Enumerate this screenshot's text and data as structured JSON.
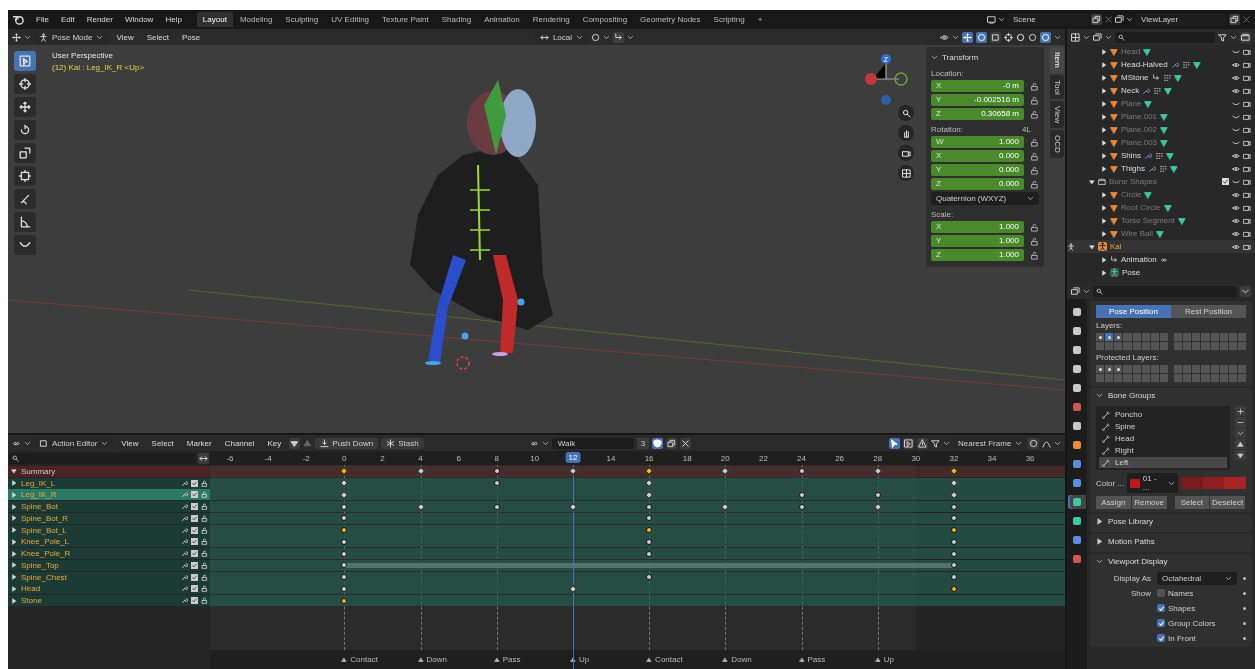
{
  "topbar": {
    "menus": [
      "File",
      "Edit",
      "Render",
      "Window",
      "Help"
    ],
    "workspaces": [
      {
        "label": "Layout",
        "selected": true
      },
      {
        "label": "Modeling",
        "selected": false
      },
      {
        "label": "Sculpting",
        "selected": false
      },
      {
        "label": "UV Editing",
        "selected": false
      },
      {
        "label": "Texture Paint",
        "selected": false
      },
      {
        "label": "Shading",
        "selected": false
      },
      {
        "label": "Animation",
        "selected": false
      },
      {
        "label": "Rendering",
        "selected": false
      },
      {
        "label": "Compositing",
        "selected": false
      },
      {
        "label": "Geometry Nodes",
        "selected": false
      },
      {
        "label": "Scripting",
        "selected": false
      }
    ],
    "add_tab": "+",
    "scene": "Scene",
    "view_layer": "ViewLayer"
  },
  "viewport": {
    "mode": "Pose Mode",
    "menus": [
      "View",
      "Select",
      "Pose"
    ],
    "orientation": "Local",
    "title": "User Perspective",
    "info": "(12) Kai : Leg_IK_R <Up>",
    "gizmo_label": "Z",
    "tools": [
      {
        "kind": "select",
        "selected": true
      },
      {
        "kind": "cursor",
        "selected": false
      },
      {
        "kind": "move",
        "selected": false
      },
      {
        "kind": "rotate",
        "selected": false
      },
      {
        "kind": "scale",
        "selected": false
      },
      {
        "kind": "transform",
        "selected": false
      },
      {
        "kind": "annotate",
        "selected": false
      },
      {
        "kind": "measure",
        "selected": false
      },
      {
        "kind": "relax",
        "selected": false
      }
    ],
    "sidebar_tabs": [
      {
        "label": "Item",
        "selected": true
      },
      {
        "label": "Tool",
        "selected": false
      },
      {
        "label": "View",
        "selected": false
      },
      {
        "label": "OCD",
        "selected": false
      }
    ],
    "transform": {
      "title": "Transform",
      "location_label": "Location:",
      "location": [
        {
          "axis": "X",
          "value": "-0 m"
        },
        {
          "axis": "Y",
          "value": "-0.002516 m"
        },
        {
          "axis": "Z",
          "value": "0.30658 m"
        }
      ],
      "rotation_label": "Rotation:",
      "rotation_badge": "4L",
      "rotation": [
        {
          "axis": "W",
          "value": "1.000"
        },
        {
          "axis": "X",
          "value": "0.000"
        },
        {
          "axis": "Y",
          "value": "0.000"
        },
        {
          "axis": "Z",
          "value": "0.000"
        }
      ],
      "rotation_mode": "Quaternion (WXYZ)",
      "scale_label": "Scale:",
      "scale": [
        {
          "axis": "X",
          "value": "1.000"
        },
        {
          "axis": "Y",
          "value": "1.000"
        },
        {
          "axis": "Z",
          "value": "1.000"
        }
      ]
    }
  },
  "outliner": {
    "items": [
      {
        "name": "Head",
        "kind": "mesh",
        "inactive": true,
        "hidden": true,
        "has_modifiers": false,
        "has_hook": false
      },
      {
        "name": "Head-Halved",
        "kind": "mesh",
        "inactive": false,
        "hidden": false,
        "has_modifiers": true,
        "has_hook": false
      },
      {
        "name": "MStone",
        "kind": "mesh",
        "inactive": false,
        "hidden": false,
        "has_modifiers": false,
        "has_hook": true
      },
      {
        "name": "Neck",
        "kind": "mesh",
        "inactive": false,
        "hidden": false,
        "has_modifiers": true,
        "has_hook": false
      },
      {
        "name": "Plane",
        "kind": "mesh",
        "inactive": true,
        "hidden": true,
        "has_modifiers": false,
        "has_hook": false
      },
      {
        "name": "Plane.001",
        "kind": "mesh",
        "inactive": true,
        "hidden": true,
        "has_modifiers": false,
        "has_hook": false
      },
      {
        "name": "Plane.002",
        "kind": "mesh",
        "inactive": true,
        "hidden": true,
        "has_modifiers": false,
        "has_hook": false
      },
      {
        "name": "Plane.003",
        "kind": "mesh",
        "inactive": true,
        "hidden": true,
        "has_modifiers": false,
        "has_hook": false
      },
      {
        "name": "Shins",
        "kind": "mesh",
        "inactive": false,
        "hidden": false,
        "has_modifiers": true,
        "has_hook": false
      },
      {
        "name": "Thighs",
        "kind": "mesh",
        "inactive": false,
        "hidden": false,
        "has_modifiers": true,
        "has_hook": false
      },
      {
        "name": "Bone Shapes",
        "kind": "collection",
        "inactive": true,
        "hidden": true,
        "checked": true,
        "expanded": true,
        "children": [
          {
            "name": "Circle",
            "kind": "mesh",
            "inactive": true,
            "hidden": false,
            "has_modifiers": false,
            "has_hook": false
          },
          {
            "name": "Root Circle",
            "kind": "mesh",
            "inactive": true,
            "hidden": false,
            "has_modifiers": false,
            "has_hook": false
          },
          {
            "name": "Torso Segment",
            "kind": "mesh",
            "inactive": true,
            "hidden": false,
            "has_modifiers": false,
            "has_hook": false
          },
          {
            "name": "Wire Ball",
            "kind": "mesh",
            "inactive": true,
            "hidden": false,
            "has_modifiers": false,
            "has_hook": false
          }
        ]
      },
      {
        "name": "Kai",
        "kind": "armature",
        "inactive": false,
        "hidden": false,
        "expanded": true,
        "children": [
          {
            "name": "Animation",
            "kind": "animation",
            "inactive": false
          },
          {
            "name": "Pose",
            "kind": "pose",
            "inactive": false
          }
        ]
      }
    ]
  },
  "properties": {
    "editor_tabs": [
      {
        "kind": "tool",
        "selected": false
      },
      {
        "kind": "render",
        "selected": false
      },
      {
        "kind": "output",
        "selected": false
      },
      {
        "kind": "view-layer",
        "selected": false
      },
      {
        "kind": "scene",
        "selected": false
      },
      {
        "kind": "world",
        "selected": false
      },
      {
        "kind": "collection",
        "selected": false
      },
      {
        "kind": "object",
        "selected": false
      },
      {
        "kind": "physics",
        "selected": false
      },
      {
        "kind": "constraint",
        "selected": false
      },
      {
        "kind": "armature",
        "selected": true
      },
      {
        "kind": "bone",
        "selected": false
      },
      {
        "kind": "bone-constraint",
        "selected": false
      },
      {
        "kind": "texture",
        "selected": false
      }
    ],
    "position_tabs": [
      {
        "label": "Pose Position",
        "selected": true
      },
      {
        "label": "Rest Position",
        "selected": false
      }
    ],
    "layers_label": "Layers:",
    "layers": [
      {
        "used": true,
        "selected": false
      },
      {
        "used": true,
        "selected": true
      },
      {
        "used": true,
        "selected": false
      }
    ],
    "protected_label": "Protected Layers:",
    "protected": [
      {
        "used": true,
        "selected": false
      },
      {
        "used": true,
        "selected": false
      },
      {
        "used": true,
        "selected": false
      }
    ],
    "bone_groups": {
      "title": "Bone Groups",
      "expanded": true,
      "items": [
        {
          "name": "Poncho",
          "selected": false
        },
        {
          "name": "Spine",
          "selected": false
        },
        {
          "name": "Head",
          "selected": false
        },
        {
          "name": "Right",
          "selected": false
        },
        {
          "name": "Left",
          "selected": true
        }
      ],
      "color_label": "Color ...",
      "color_value": "01 - ...",
      "swatches": [
        {
          "color": "#7a1b1e"
        },
        {
          "color": "#8e1f22"
        },
        {
          "color": "#a62326"
        }
      ],
      "buttons": [
        "Assign",
        "Remove",
        "Select",
        "Deselect"
      ]
    },
    "panels": [
      {
        "title": "Pose Library",
        "expanded": false
      },
      {
        "title": "Motion Paths",
        "expanded": false
      }
    ],
    "viewport_display": {
      "title": "Viewport Display",
      "expanded": true,
      "display_as_label": "Display As",
      "display_as": "Octahedral",
      "show_label": "Show",
      "options": [
        {
          "label": "Names",
          "checked": false
        },
        {
          "label": "Shapes",
          "checked": true
        },
        {
          "label": "Group Colors",
          "checked": true
        },
        {
          "label": "In Front",
          "checked": true
        }
      ]
    }
  },
  "action_editor": {
    "mode": "Action Editor",
    "menus": [
      "View",
      "Select",
      "Marker",
      "Channel",
      "Key"
    ],
    "push_down": "Push Down",
    "stash": "Stash",
    "action": "Walk",
    "users": "3",
    "fake_user": true,
    "snap": "Nearest Frame"
  },
  "dopesheet": {
    "ticks": [
      "-6",
      "-4",
      "-2",
      "0",
      "2",
      "4",
      "6",
      "8",
      "10",
      "14",
      "16",
      "18",
      "20",
      "22",
      "24",
      "26",
      "28",
      "30",
      "32",
      "34",
      "36"
    ],
    "current_frame": "12",
    "channels": [
      {
        "name": "Summary",
        "kind": "summary",
        "expanded": true,
        "selected": false,
        "hold": false,
        "keys": [
          {
            "kind": "diamond",
            "selected": true
          },
          {
            "kind": "diamond",
            "selected": false
          },
          {
            "kind": "circle",
            "selected": false
          },
          {
            "kind": "diamond",
            "selected": false
          },
          {
            "kind": "diamond",
            "selected": true
          },
          {
            "kind": "diamond",
            "selected": false
          },
          {
            "kind": "circle",
            "selected": false
          },
          {
            "kind": "diamond",
            "selected": false
          },
          {
            "kind": "diamond",
            "selected": true
          }
        ]
      },
      {
        "name": "Leg_IK_L",
        "kind": "group",
        "expanded": false,
        "selected": false,
        "hold": false,
        "keys": [
          {
            "kind": "diamond",
            "selected": false
          },
          {
            "kind": "none"
          },
          {
            "kind": "circle",
            "selected": false
          },
          {
            "kind": "none"
          },
          {
            "kind": "diamond",
            "selected": false
          },
          {
            "kind": "none"
          },
          {
            "kind": "none"
          },
          {
            "kind": "none"
          },
          {
            "kind": "diamond",
            "selected": false
          }
        ]
      },
      {
        "name": "Leg_IK_R",
        "kind": "group",
        "expanded": false,
        "selected": true,
        "hold": false,
        "keys": [
          {
            "kind": "diamond",
            "selected": false
          },
          {
            "kind": "none"
          },
          {
            "kind": "none"
          },
          {
            "kind": "none"
          },
          {
            "kind": "diamond",
            "selected": false
          },
          {
            "kind": "none"
          },
          {
            "kind": "circle",
            "selected": false
          },
          {
            "kind": "circle",
            "selected": false
          },
          {
            "kind": "diamond",
            "selected": false
          }
        ]
      },
      {
        "name": "Spine_Bot",
        "kind": "group",
        "expanded": false,
        "selected": false,
        "hold": false,
        "keys": [
          {
            "kind": "circle",
            "selected": false
          },
          {
            "kind": "diamond",
            "selected": false
          },
          {
            "kind": "circle",
            "selected": false
          },
          {
            "kind": "diamond",
            "selected": false
          },
          {
            "kind": "circle",
            "selected": false
          },
          {
            "kind": "diamond",
            "selected": false
          },
          {
            "kind": "circle",
            "selected": false
          },
          {
            "kind": "diamond",
            "selected": false
          },
          {
            "kind": "circle",
            "selected": false
          }
        ]
      },
      {
        "name": "Spine_Bot_R",
        "kind": "group",
        "expanded": false,
        "selected": false,
        "hold": false,
        "keys": [
          {
            "kind": "circle",
            "selected": false
          },
          {
            "kind": "none"
          },
          {
            "kind": "none"
          },
          {
            "kind": "none"
          },
          {
            "kind": "circle",
            "selected": false
          },
          {
            "kind": "none"
          },
          {
            "kind": "none"
          },
          {
            "kind": "none"
          },
          {
            "kind": "circle",
            "selected": false
          }
        ]
      },
      {
        "name": "Spine_Bot_L",
        "kind": "group",
        "expanded": false,
        "selected": false,
        "hold": false,
        "keys": [
          {
            "kind": "circle",
            "selected": true
          },
          {
            "kind": "none"
          },
          {
            "kind": "none"
          },
          {
            "kind": "none"
          },
          {
            "kind": "circle",
            "selected": true
          },
          {
            "kind": "none"
          },
          {
            "kind": "none"
          },
          {
            "kind": "none"
          },
          {
            "kind": "circle",
            "selected": true
          }
        ]
      },
      {
        "name": "Knee_Pole_L",
        "kind": "group",
        "expanded": false,
        "selected": false,
        "hold": false,
        "keys": [
          {
            "kind": "circle",
            "selected": false
          },
          {
            "kind": "none"
          },
          {
            "kind": "none"
          },
          {
            "kind": "none"
          },
          {
            "kind": "circle",
            "selected": false
          },
          {
            "kind": "none"
          },
          {
            "kind": "none"
          },
          {
            "kind": "none"
          },
          {
            "kind": "circle",
            "selected": false
          }
        ]
      },
      {
        "name": "Knee_Pole_R",
        "kind": "group",
        "expanded": false,
        "selected": false,
        "hold": false,
        "keys": [
          {
            "kind": "circle",
            "selected": false
          },
          {
            "kind": "none"
          },
          {
            "kind": "none"
          },
          {
            "kind": "none"
          },
          {
            "kind": "circle",
            "selected": false
          },
          {
            "kind": "none"
          },
          {
            "kind": "none"
          },
          {
            "kind": "none"
          },
          {
            "kind": "circle",
            "selected": false
          }
        ]
      },
      {
        "name": "Spine_Top",
        "kind": "group",
        "expanded": false,
        "selected": false,
        "hold": true,
        "keys": [
          {
            "kind": "circle",
            "selected": false
          },
          {
            "kind": "none"
          },
          {
            "kind": "none"
          },
          {
            "kind": "none"
          },
          {
            "kind": "none"
          },
          {
            "kind": "none"
          },
          {
            "kind": "none"
          },
          {
            "kind": "none"
          },
          {
            "kind": "circle",
            "selected": false
          }
        ]
      },
      {
        "name": "Spine_Chest",
        "kind": "group",
        "expanded": false,
        "selected": false,
        "hold": false,
        "keys": [
          {
            "kind": "circle",
            "selected": false
          },
          {
            "kind": "none"
          },
          {
            "kind": "none"
          },
          {
            "kind": "none"
          },
          {
            "kind": "circle",
            "selected": false
          },
          {
            "kind": "none"
          },
          {
            "kind": "none"
          },
          {
            "kind": "none"
          },
          {
            "kind": "circle",
            "selected": false
          }
        ]
      },
      {
        "name": "Head",
        "kind": "group",
        "expanded": false,
        "selected": false,
        "hold": false,
        "keys": [
          {
            "kind": "circle",
            "selected": false
          },
          {
            "kind": "none"
          },
          {
            "kind": "none"
          },
          {
            "kind": "diamond",
            "selected": false
          },
          {
            "kind": "none"
          },
          {
            "kind": "none"
          },
          {
            "kind": "none"
          },
          {
            "kind": "none"
          },
          {
            "kind": "circle",
            "selected": true
          }
        ]
      },
      {
        "name": "Stone",
        "kind": "group",
        "expanded": false,
        "selected": false,
        "hold": false,
        "keys": [
          {
            "kind": "circle",
            "selected": true
          }
        ]
      }
    ],
    "markers": [
      {
        "label": "Contact"
      },
      {
        "label": "Down"
      },
      {
        "label": "Pass"
      },
      {
        "label": "Up"
      },
      {
        "label": "Contact"
      },
      {
        "label": "Down"
      },
      {
        "label": "Pass"
      },
      {
        "label": "Up"
      }
    ]
  }
}
